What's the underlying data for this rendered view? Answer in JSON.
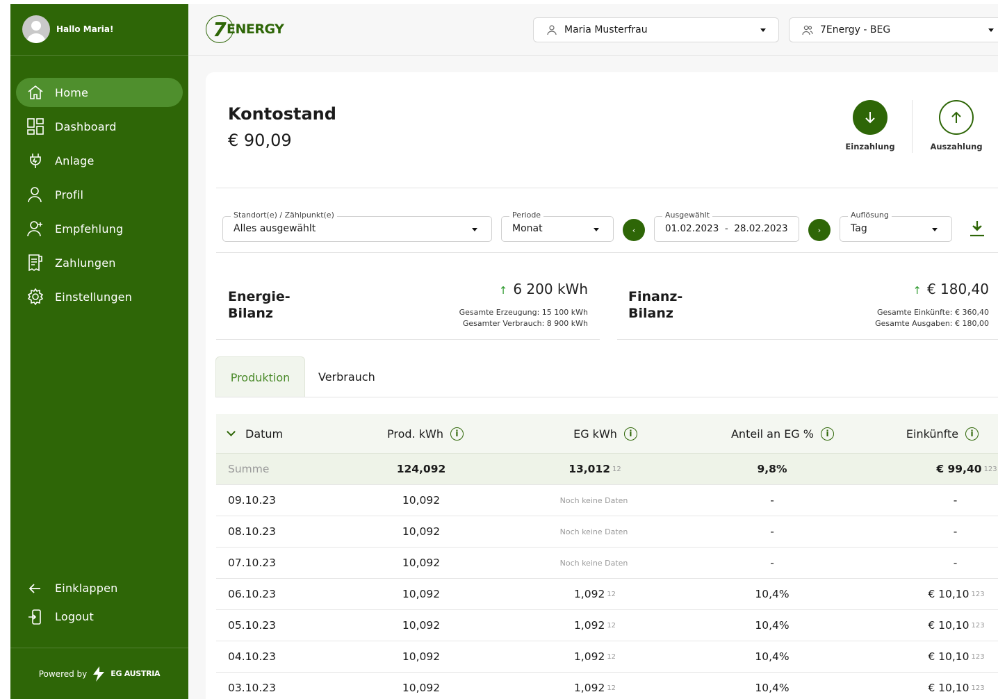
{
  "sidebar": {
    "greeting": "Hallo Maria!",
    "items": [
      {
        "label": "Home",
        "icon": "home-icon"
      },
      {
        "label": "Dashboard",
        "icon": "dashboard-icon"
      },
      {
        "label": "Anlage",
        "icon": "plug-icon"
      },
      {
        "label": "Profil",
        "icon": "user-icon"
      },
      {
        "label": "Empfehlung",
        "icon": "user-plus-icon"
      },
      {
        "label": "Zahlungen",
        "icon": "receipt-icon"
      },
      {
        "label": "Einstellungen",
        "icon": "gear-icon"
      }
    ],
    "collapse": "Einklappen",
    "logout": "Logout",
    "powered_by": "Powered by",
    "powered_brand": "EG AUSTRIA"
  },
  "header": {
    "logo_digit": "7",
    "logo_word": "ENERGY",
    "user_select": "Maria Musterfrau",
    "community_select": "7Energy - BEG"
  },
  "account": {
    "title": "Kontostand",
    "balance": "€ 90,09",
    "deposit": "Einzahlung",
    "withdraw": "Auszahlung"
  },
  "filters": {
    "location_label": "Standort(e) / Zählpunkt(e)",
    "location_value": "Alles ausgewählt",
    "period_label": "Periode",
    "period_value": "Monat",
    "selected_label": "Ausgewählt",
    "selected_value": "01.02.2023  -  28.02.2023",
    "resolution_label": "Auflösung",
    "resolution_value": "Tag",
    "prev": "‹",
    "next": "›"
  },
  "energy": {
    "title_1": "Energie-",
    "title_2": "Bilanz",
    "value": "6 200 kWh",
    "line1": "Gesamte Erzeugung: 15 100 kWh",
    "line2": "Gesamter Verbrauch: 8 900 kWh"
  },
  "finance": {
    "title_1": "Finanz-",
    "title_2": "Bilanz",
    "value": "€ 180,40",
    "line1": "Gesamte Einkünfte: € 360,40",
    "line2": "Gesamte Ausgaben: € 180,00"
  },
  "tabs": {
    "production": "Produktion",
    "consumption": "Verbrauch"
  },
  "table": {
    "headers": [
      "Datum",
      "Prod. kWh",
      "EG kWh",
      "Anteil an EG %",
      "Einkünfte"
    ],
    "sum": {
      "label": "Summe",
      "prod": "124,092",
      "eg": "13,012",
      "eg_sup": "12",
      "share": "9,8%",
      "income": "€ 99,40",
      "income_sup": "123"
    },
    "rows": [
      {
        "date": "09.10.23",
        "prod": "10,092",
        "eg": "Noch keine Daten",
        "eg_sup": "",
        "share": "-",
        "income": "-",
        "income_sup": ""
      },
      {
        "date": "08.10.23",
        "prod": "10,092",
        "eg": "Noch keine Daten",
        "eg_sup": "",
        "share": "-",
        "income": "-",
        "income_sup": ""
      },
      {
        "date": "07.10.23",
        "prod": "10,092",
        "eg": "Noch keine Daten",
        "eg_sup": "",
        "share": "-",
        "income": "-",
        "income_sup": ""
      },
      {
        "date": "06.10.23",
        "prod": "10,092",
        "eg": "1,092",
        "eg_sup": "12",
        "share": "10,4%",
        "income": "€ 10,10",
        "income_sup": "123"
      },
      {
        "date": "05.10.23",
        "prod": "10,092",
        "eg": "1,092",
        "eg_sup": "12",
        "share": "10,4%",
        "income": "€ 10,10",
        "income_sup": "123"
      },
      {
        "date": "04.10.23",
        "prod": "10,092",
        "eg": "1,092",
        "eg_sup": "12",
        "share": "10,4%",
        "income": "€ 10,10",
        "income_sup": "123"
      },
      {
        "date": "03.10.23",
        "prod": "10,092",
        "eg": "1,092",
        "eg_sup": "12",
        "share": "10,4%",
        "income": "€ 10,10",
        "income_sup": "123"
      }
    ]
  },
  "colors": {
    "brand": "#2e6607",
    "active_nav": "#4f8f2d",
    "accent_up": "#2e9a2e"
  }
}
